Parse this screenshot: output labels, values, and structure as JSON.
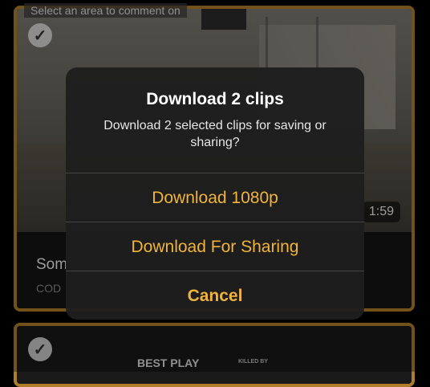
{
  "hint": "Select an area to comment on",
  "clips": [
    {
      "title": "Som",
      "subtitle": "COD",
      "duration": "1:59"
    },
    {
      "overlay_text": "BEST PLAY",
      "killed_text": "KILLED BY"
    }
  ],
  "dialog": {
    "title": "Download 2 clips",
    "message": "Download 2 selected clips for saving or sharing?",
    "buttons": {
      "download_1080p": "Download 1080p",
      "download_sharing": "Download For Sharing",
      "cancel": "Cancel"
    }
  },
  "colors": {
    "accent": "#f0b43c",
    "card_border": "#b07d2a"
  }
}
